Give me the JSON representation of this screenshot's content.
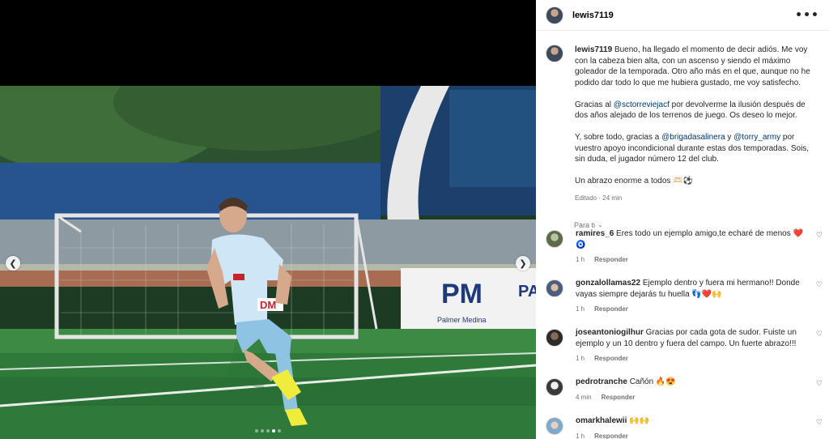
{
  "post": {
    "username": "lewis7119",
    "more_icon": "more-horizontal-icon"
  },
  "caption": {
    "username": "lewis7119",
    "p1": "Bueno, ha llegado el momento de decir adiós. Me voy con la cabeza bien alta, con un ascenso y siendo el máximo goleador de la temporada. Otro año más en el que, aunque no he podido dar todo lo que me hubiera gustado, me voy satisfecho.",
    "p2_before": "Gracias al ",
    "p2_mention": "@sctorreviejacf",
    "p2_after": " por devolverme la ilusión después de dos años alejado de los terrenos de juego. Os deseo lo mejor.",
    "p3_before": "Y, sobre todo, gracias a ",
    "p3_mention1": "@brigadasalinera",
    "p3_mid": " y ",
    "p3_mention2": "@torry_army",
    "p3_after": " por vuestro apoyo incondicional durante estas dos temporadas. Sois, sin duda, el jugador número 12 del club.",
    "p4": "Un abrazo enorme a todos 🫶🏻⚽",
    "meta": "Editado · 24 min"
  },
  "sort_label": "Para ti",
  "comments": [
    {
      "user": "ramires_6",
      "text": "Eres todo un ejemplo amigo,te echaré de menos ❤️ 🧿",
      "time": "1 h",
      "reply": "Responder"
    },
    {
      "user": "gonzalollamas22",
      "text": "Ejemplo dentro y fuera mi hermano!! Donde vayas siempre dejarás tu huella 👣❤️🙌",
      "time": "1 h",
      "reply": "Responder"
    },
    {
      "user": "joseantoniogilhur",
      "text": "Gracias por cada gota de sudor. Fuiste un ejemplo y un 10 dentro y fuera del campo. Un fuerte abrazo!!!",
      "time": "1 h",
      "reply": "Responder"
    },
    {
      "user": "pedrotranche",
      "text": "Cañón 🔥😍",
      "time": "4 min",
      "reply": "Responder"
    },
    {
      "user": "omarkhalewii",
      "text": "🙌🙌",
      "time": "1 h",
      "reply": "Responder"
    }
  ],
  "media": {
    "slides_total": 5,
    "slide_active": 4,
    "sponsor_letters": "PM",
    "sponsor_letters_2": "PA",
    "sponsor_sub": "Palmer Medina",
    "jersey_text": "DM"
  },
  "colors": {
    "mention": "#00376b",
    "meta_gray": "#737373",
    "jersey": "#cfe6f7",
    "grass": "#2f7a3b"
  }
}
